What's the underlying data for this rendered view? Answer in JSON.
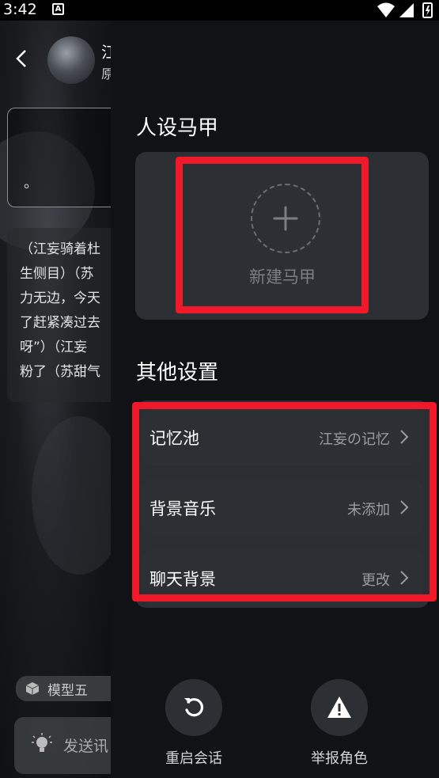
{
  "status_bar": {
    "time": "3:42",
    "notification_badge": "A"
  },
  "background_chat": {
    "name_partial": "江",
    "sub_partial": "原",
    "card_text": "。",
    "message_lines": [
      "（江妄骑着杜",
      "生侧目）（苏",
      "力无边，今天",
      "了赶紧凑过去",
      "呀”）（江妄",
      "粉了（苏甜气"
    ],
    "model_chip": "模型五",
    "send_placeholder": "发送讯"
  },
  "drawer": {
    "persona_section_title": "人设马甲",
    "new_persona_label": "新建马甲",
    "other_section_title": "其他设置",
    "settings": [
      {
        "name": "记忆池",
        "value": "江妄の记忆"
      },
      {
        "name": "背景音乐",
        "value": "未添加"
      },
      {
        "name": "聊天背景",
        "value": "更改"
      }
    ],
    "actions": {
      "restart_label": "重启会话",
      "report_label": "举报角色"
    }
  },
  "colors": {
    "drawer_bg": "#111216",
    "card_bg": "#2c2f34",
    "highlight_red": "#f0192a",
    "muted_text": "#9a9da2"
  }
}
